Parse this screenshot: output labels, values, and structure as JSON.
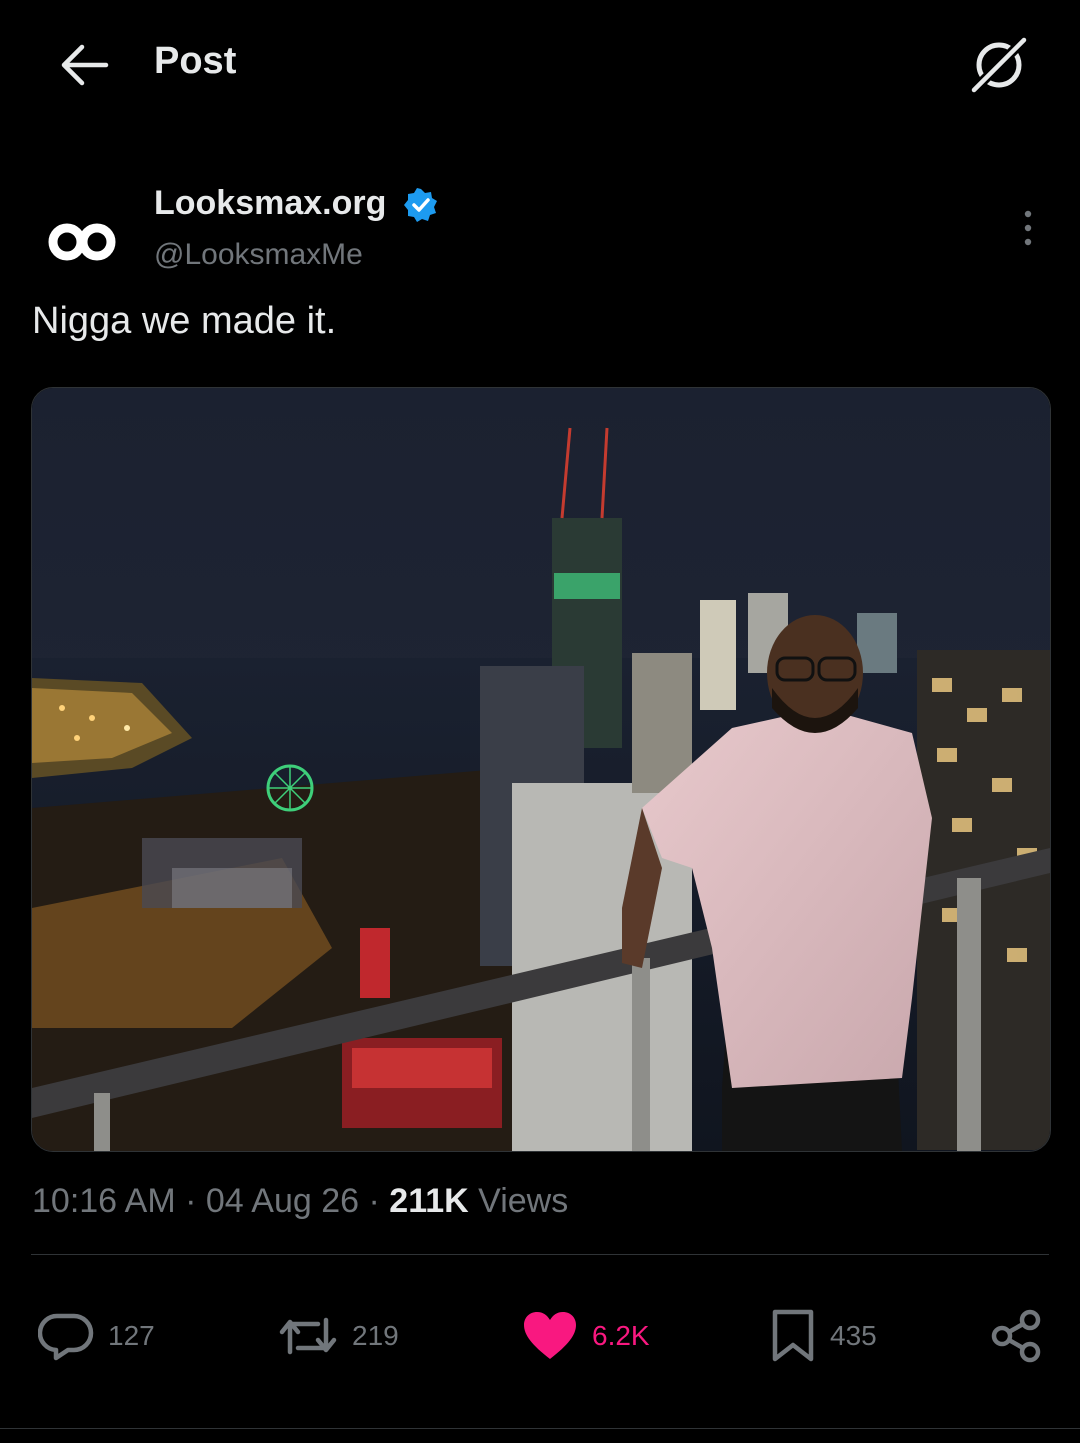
{
  "topbar": {
    "title": "Post",
    "back_icon": "arrow-left-icon",
    "right_icon": "grok-icon"
  },
  "post": {
    "author": {
      "display_name": "Looksmax.org",
      "handle": "@LooksmaxMe",
      "verified": true,
      "avatar_icon": "infinity-logo-icon"
    },
    "text": "Nigga we made it.",
    "media": {
      "kind": "photo",
      "icon": "night-city-balcony-photo"
    },
    "time": "10:16 AM",
    "date": "04 Aug 26",
    "views_count": "211K",
    "views_label": "Views",
    "separator": "·"
  },
  "actions": {
    "replies": "127",
    "reposts": "219",
    "likes": "6.2K",
    "bookmarks": "435"
  },
  "colors": {
    "background": "#000000",
    "text": "#e7e9ea",
    "muted": "#71767b",
    "verified": "#1d9bf0",
    "like": "#f91880",
    "divider": "#2f3336"
  }
}
